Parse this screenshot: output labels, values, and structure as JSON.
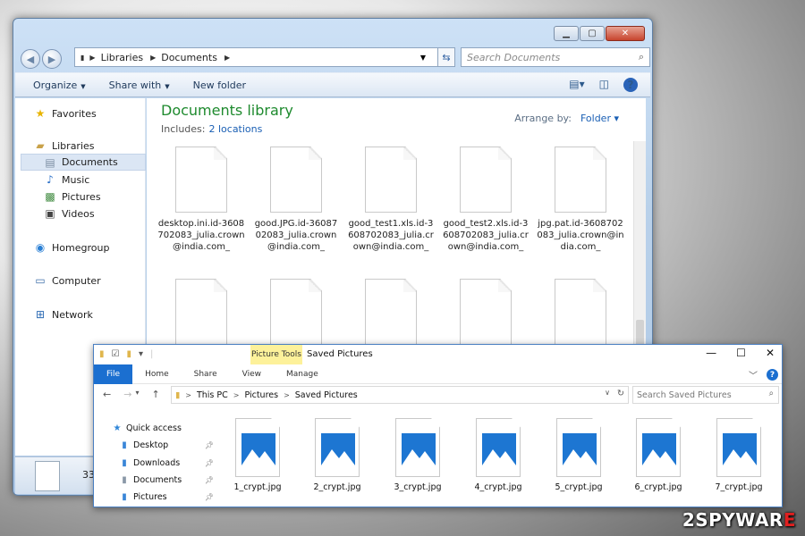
{
  "win7": {
    "breadcrumb": [
      "Libraries",
      "Documents"
    ],
    "search_placeholder": "Search Documents",
    "toolbar": {
      "organize": "Organize",
      "share_with": "Share with",
      "new_folder": "New folder"
    },
    "sidebar": [
      {
        "label": "Favorites",
        "icon": "star-icon"
      },
      {
        "label": "Libraries",
        "icon": "library-icon"
      },
      {
        "label": "Documents",
        "icon": "documents-icon",
        "selected": true
      },
      {
        "label": "Music",
        "icon": "music-icon"
      },
      {
        "label": "Pictures",
        "icon": "pictures-icon"
      },
      {
        "label": "Videos",
        "icon": "videos-icon"
      },
      {
        "label": "Homegroup",
        "icon": "homegroup-icon"
      },
      {
        "label": "Computer",
        "icon": "computer-icon"
      },
      {
        "label": "Network",
        "icon": "network-icon"
      }
    ],
    "library_title": "Documents library",
    "includes_label": "Includes:",
    "includes_link": "2 locations",
    "arrange_label": "Arrange by:",
    "arrange_value": "Folder",
    "files": [
      "desktop.ini.id-3608702083_julia.crown@india.com_",
      "good.JPG.id-3608702083_julia.crown@india.com_",
      "good_test1.xls.id-3608702083_julia.crown@india.com_",
      "good_test2.xls.id-3608702083_julia.crown@india.com_",
      "jpg.pat.id-3608702083_julia.crown@india.com_"
    ],
    "status_count": "33"
  },
  "win10": {
    "context_tab": "Picture Tools",
    "window_title": "Saved Pictures",
    "tabs": [
      "File",
      "Home",
      "Share",
      "View",
      "Manage"
    ],
    "address": [
      "This PC",
      "Pictures",
      "Saved Pictures"
    ],
    "search_placeholder": "Search Saved Pictures",
    "sidebar": [
      {
        "label": "Quick access",
        "icon": "star-icon"
      },
      {
        "label": "Desktop",
        "icon": "folder-icon"
      },
      {
        "label": "Downloads",
        "icon": "folder-icon"
      },
      {
        "label": "Documents",
        "icon": "folder-icon"
      },
      {
        "label": "Pictures",
        "icon": "folder-icon"
      }
    ],
    "files": [
      "1_crypt.jpg",
      "2_crypt.jpg",
      "3_crypt.jpg",
      "4_crypt.jpg",
      "5_crypt.jpg",
      "6_crypt.jpg",
      "7_crypt.jpg"
    ]
  },
  "watermark": {
    "num": "2",
    "a": "SPYWAR",
    "b": "E"
  }
}
